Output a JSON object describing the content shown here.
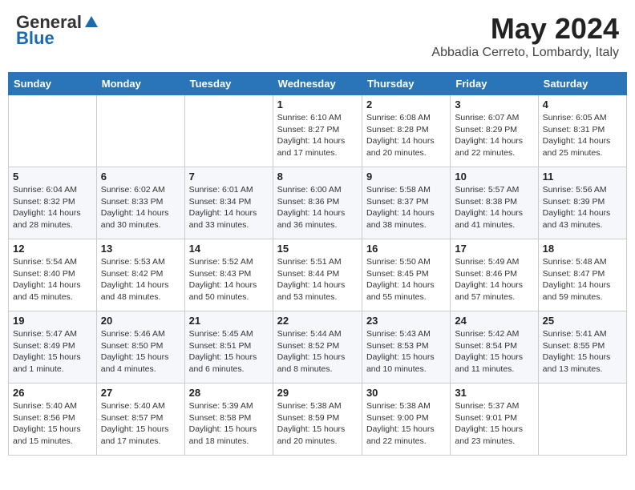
{
  "logo": {
    "general": "General",
    "blue": "Blue"
  },
  "title": {
    "month": "May 2024",
    "location": "Abbadia Cerreto, Lombardy, Italy"
  },
  "weekdays": [
    "Sunday",
    "Monday",
    "Tuesday",
    "Wednesday",
    "Thursday",
    "Friday",
    "Saturday"
  ],
  "weeks": [
    [
      {
        "day": "",
        "info": ""
      },
      {
        "day": "",
        "info": ""
      },
      {
        "day": "",
        "info": ""
      },
      {
        "day": "1",
        "info": "Sunrise: 6:10 AM\nSunset: 8:27 PM\nDaylight: 14 hours and 17 minutes."
      },
      {
        "day": "2",
        "info": "Sunrise: 6:08 AM\nSunset: 8:28 PM\nDaylight: 14 hours and 20 minutes."
      },
      {
        "day": "3",
        "info": "Sunrise: 6:07 AM\nSunset: 8:29 PM\nDaylight: 14 hours and 22 minutes."
      },
      {
        "day": "4",
        "info": "Sunrise: 6:05 AM\nSunset: 8:31 PM\nDaylight: 14 hours and 25 minutes."
      }
    ],
    [
      {
        "day": "5",
        "info": "Sunrise: 6:04 AM\nSunset: 8:32 PM\nDaylight: 14 hours and 28 minutes."
      },
      {
        "day": "6",
        "info": "Sunrise: 6:02 AM\nSunset: 8:33 PM\nDaylight: 14 hours and 30 minutes."
      },
      {
        "day": "7",
        "info": "Sunrise: 6:01 AM\nSunset: 8:34 PM\nDaylight: 14 hours and 33 minutes."
      },
      {
        "day": "8",
        "info": "Sunrise: 6:00 AM\nSunset: 8:36 PM\nDaylight: 14 hours and 36 minutes."
      },
      {
        "day": "9",
        "info": "Sunrise: 5:58 AM\nSunset: 8:37 PM\nDaylight: 14 hours and 38 minutes."
      },
      {
        "day": "10",
        "info": "Sunrise: 5:57 AM\nSunset: 8:38 PM\nDaylight: 14 hours and 41 minutes."
      },
      {
        "day": "11",
        "info": "Sunrise: 5:56 AM\nSunset: 8:39 PM\nDaylight: 14 hours and 43 minutes."
      }
    ],
    [
      {
        "day": "12",
        "info": "Sunrise: 5:54 AM\nSunset: 8:40 PM\nDaylight: 14 hours and 45 minutes."
      },
      {
        "day": "13",
        "info": "Sunrise: 5:53 AM\nSunset: 8:42 PM\nDaylight: 14 hours and 48 minutes."
      },
      {
        "day": "14",
        "info": "Sunrise: 5:52 AM\nSunset: 8:43 PM\nDaylight: 14 hours and 50 minutes."
      },
      {
        "day": "15",
        "info": "Sunrise: 5:51 AM\nSunset: 8:44 PM\nDaylight: 14 hours and 53 minutes."
      },
      {
        "day": "16",
        "info": "Sunrise: 5:50 AM\nSunset: 8:45 PM\nDaylight: 14 hours and 55 minutes."
      },
      {
        "day": "17",
        "info": "Sunrise: 5:49 AM\nSunset: 8:46 PM\nDaylight: 14 hours and 57 minutes."
      },
      {
        "day": "18",
        "info": "Sunrise: 5:48 AM\nSunset: 8:47 PM\nDaylight: 14 hours and 59 minutes."
      }
    ],
    [
      {
        "day": "19",
        "info": "Sunrise: 5:47 AM\nSunset: 8:49 PM\nDaylight: 15 hours and 1 minute."
      },
      {
        "day": "20",
        "info": "Sunrise: 5:46 AM\nSunset: 8:50 PM\nDaylight: 15 hours and 4 minutes."
      },
      {
        "day": "21",
        "info": "Sunrise: 5:45 AM\nSunset: 8:51 PM\nDaylight: 15 hours and 6 minutes."
      },
      {
        "day": "22",
        "info": "Sunrise: 5:44 AM\nSunset: 8:52 PM\nDaylight: 15 hours and 8 minutes."
      },
      {
        "day": "23",
        "info": "Sunrise: 5:43 AM\nSunset: 8:53 PM\nDaylight: 15 hours and 10 minutes."
      },
      {
        "day": "24",
        "info": "Sunrise: 5:42 AM\nSunset: 8:54 PM\nDaylight: 15 hours and 11 minutes."
      },
      {
        "day": "25",
        "info": "Sunrise: 5:41 AM\nSunset: 8:55 PM\nDaylight: 15 hours and 13 minutes."
      }
    ],
    [
      {
        "day": "26",
        "info": "Sunrise: 5:40 AM\nSunset: 8:56 PM\nDaylight: 15 hours and 15 minutes."
      },
      {
        "day": "27",
        "info": "Sunrise: 5:40 AM\nSunset: 8:57 PM\nDaylight: 15 hours and 17 minutes."
      },
      {
        "day": "28",
        "info": "Sunrise: 5:39 AM\nSunset: 8:58 PM\nDaylight: 15 hours and 18 minutes."
      },
      {
        "day": "29",
        "info": "Sunrise: 5:38 AM\nSunset: 8:59 PM\nDaylight: 15 hours and 20 minutes."
      },
      {
        "day": "30",
        "info": "Sunrise: 5:38 AM\nSunset: 9:00 PM\nDaylight: 15 hours and 22 minutes."
      },
      {
        "day": "31",
        "info": "Sunrise: 5:37 AM\nSunset: 9:01 PM\nDaylight: 15 hours and 23 minutes."
      },
      {
        "day": "",
        "info": ""
      }
    ]
  ]
}
